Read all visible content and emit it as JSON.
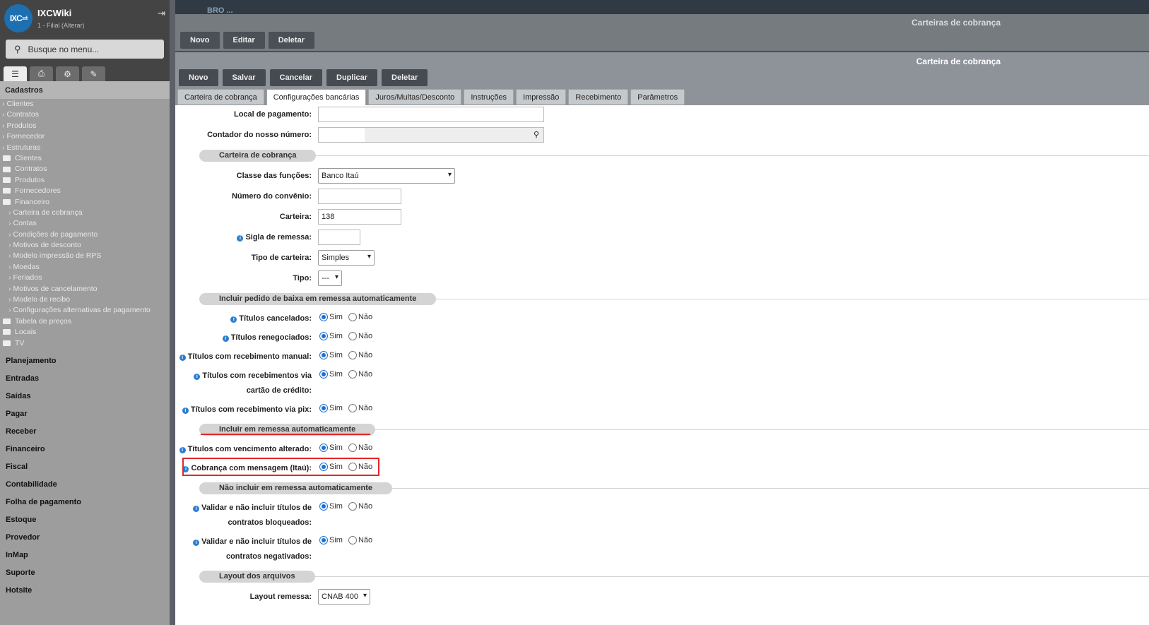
{
  "app": {
    "name": "IXCWiki",
    "branch": "1 - Filial (Alterar)",
    "logo": "IXC",
    "logo_sub": "soft"
  },
  "search": {
    "placeholder": "Busque no menu..."
  },
  "sidebar": {
    "section": "Cadastros",
    "tree": [
      {
        "label": "Clientes",
        "kind": "top"
      },
      {
        "label": "Contratos",
        "kind": "top"
      },
      {
        "label": "Produtos",
        "kind": "top"
      },
      {
        "label": "Fornecedor",
        "kind": "top"
      },
      {
        "label": "Estruturas",
        "kind": "top"
      },
      {
        "label": "Clientes",
        "kind": "folder"
      },
      {
        "label": "Contratos",
        "kind": "folder"
      },
      {
        "label": "Produtos",
        "kind": "folder"
      },
      {
        "label": "Fornecedores",
        "kind": "folder"
      },
      {
        "label": "Financeiro",
        "kind": "folder"
      },
      {
        "label": "Carteira de cobrança",
        "kind": "sub"
      },
      {
        "label": "Contas",
        "kind": "sub"
      },
      {
        "label": "Condições de pagamento",
        "kind": "sub"
      },
      {
        "label": "Motivos de desconto",
        "kind": "sub"
      },
      {
        "label": "Modelo impressão de RPS",
        "kind": "sub"
      },
      {
        "label": "Moedas",
        "kind": "sub"
      },
      {
        "label": "Feriados",
        "kind": "sub"
      },
      {
        "label": "Motivos de cancelamento",
        "kind": "sub"
      },
      {
        "label": "Modelo de recibo",
        "kind": "sub"
      },
      {
        "label": "Configurações alternativas de pagamento",
        "kind": "sub"
      },
      {
        "label": "Tabela de preços",
        "kind": "folder"
      },
      {
        "label": "Locais",
        "kind": "folder"
      },
      {
        "label": "TV",
        "kind": "folder"
      }
    ],
    "menu": [
      "Planejamento",
      "Entradas",
      "Saídas",
      "Pagar",
      "Receber",
      "Financeiro",
      "Fiscal",
      "Contabilidade",
      "Folha de pagamento",
      "Estoque",
      "Provedor",
      "InMap",
      "Suporte",
      "Hotsite"
    ]
  },
  "topbar": {
    "text": "BRO ..."
  },
  "outer": {
    "title": "Carteiras de cobrança",
    "buttons": [
      "Novo",
      "Editar",
      "Deletar"
    ]
  },
  "inner": {
    "title": "Carteira de cobrança",
    "buttons": [
      "Novo",
      "Salvar",
      "Cancelar",
      "Duplicar",
      "Deletar"
    ],
    "tabs": [
      "Carteira de cobrança",
      "Configurações bancárias",
      "Juros/Multas/Desconto",
      "Instruções",
      "Impressão",
      "Recebimento",
      "Parâmetros"
    ],
    "active_tab": "Configurações bancárias"
  },
  "form": {
    "local_pagamento": {
      "label": "Local de pagamento:",
      "value": ""
    },
    "contador": {
      "label": "Contador do nosso número:",
      "value": ""
    },
    "sec1": "Carteira de cobrança",
    "classe": {
      "label": "Classe das funções:",
      "value": "Banco Itaú"
    },
    "convenio": {
      "label": "Número do convênio:",
      "value": ""
    },
    "carteira": {
      "label": "Carteira:",
      "value": "138"
    },
    "sigla": {
      "label": "Sigla de remessa:",
      "value": ""
    },
    "tipo_carteira": {
      "label": "Tipo de carteira:",
      "value": "Simples"
    },
    "tipo": {
      "label": "Tipo:",
      "value": "---"
    },
    "sec2": "Incluir pedido de baixa em remessa automaticamente",
    "r1": {
      "label": "Títulos cancelados:",
      "value": "Sim"
    },
    "r2": {
      "label": "Títulos renegociados:",
      "value": "Sim"
    },
    "r3": {
      "label": "Títulos com recebimento manual:",
      "value": "Sim"
    },
    "r4": {
      "label_a": "Títulos com recebimentos via",
      "label_b": "cartão de crédito:",
      "value": "Sim"
    },
    "r5": {
      "label": "Títulos com recebimento via pix:",
      "value": "Sim"
    },
    "sec3": "Incluir em remessa automaticamente",
    "r6": {
      "label": "Títulos com vencimento alterado:",
      "value": "Sim"
    },
    "r7": {
      "label": "Cobrança com mensagem (Itaú):",
      "value": "Sim"
    },
    "sec4": "Não incluir em remessa automaticamente",
    "r8": {
      "label_a": "Validar e não incluir títulos de",
      "label_b": "contratos bloqueados:",
      "value": "Sim"
    },
    "r9": {
      "label_a": "Validar e não incluir títulos de",
      "label_b": "contratos negativados:",
      "value": "Sim"
    },
    "sec5": "Layout dos arquivos",
    "layout": {
      "label": "Layout remessa:",
      "value": "CNAB 400"
    },
    "yes": "Sim",
    "no": "Não"
  },
  "colors": {
    "highlight": "#e2262b",
    "radio_accent": "#1d6fd1"
  }
}
